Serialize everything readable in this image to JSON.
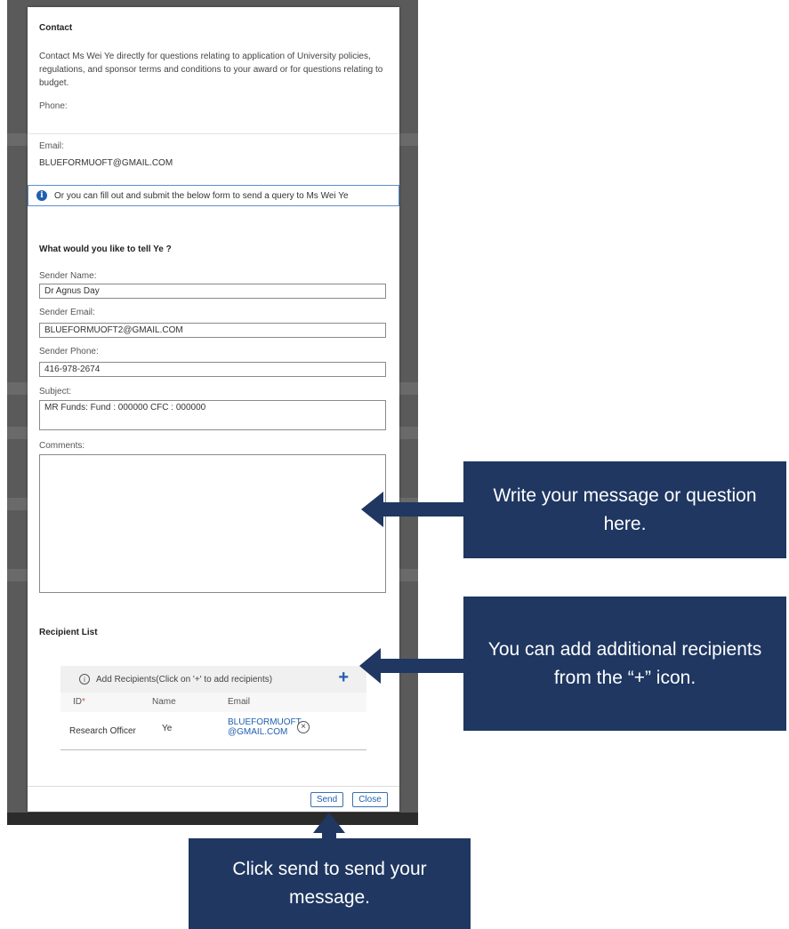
{
  "dialog": {
    "title": "Contact",
    "description": "Contact Ms Wei Ye directly for questions relating to application of University policies, regulations, and sponsor terms and conditions to your award or for questions relating to budget.",
    "phone_label": "Phone:",
    "email_label": "Email:",
    "email_value": "BLUEFORMUOFT@GMAIL.COM",
    "info_text": "Or you can fill out and submit the below form to send a query to Ms Wei Ye",
    "form_heading": "What would you like to tell Ye ?",
    "sender_name_label": "Sender Name:",
    "sender_name_value": "Dr Agnus Day",
    "sender_email_label": "Sender Email:",
    "sender_email_value": "BLUEFORMUOFT2@GMAIL.COM",
    "sender_phone_label": "Sender Phone:",
    "sender_phone_value": "416-978-2674",
    "subject_label": "Subject:",
    "subject_value": "MR Funds: Fund : 000000 CFC : 000000",
    "comments_label": "Comments:",
    "comments_value": "",
    "recipient_list_label": "Recipient List",
    "add_recipients_text": "Add Recipients(Click on '+' to add recipients)",
    "add_icon": "+",
    "columns": {
      "id": "ID",
      "required_mark": "*",
      "name": "Name",
      "email": "Email"
    },
    "recipients": [
      {
        "id": "Research Officer",
        "name": "Ye",
        "email_line1": "BLUEFORMUOFT",
        "email_line2": "@GMAIL.COM"
      }
    ],
    "send_label": "Send",
    "close_label": "Close"
  },
  "callouts": {
    "comments_hint": "Write your message or question here.",
    "recipients_hint": "You can add additional recipients from the “+” icon.",
    "send_hint": "Click send to send your message."
  },
  "colors": {
    "callout_bg": "#1f3761",
    "accent": "#1f5fb0",
    "required": "#d9534f"
  }
}
